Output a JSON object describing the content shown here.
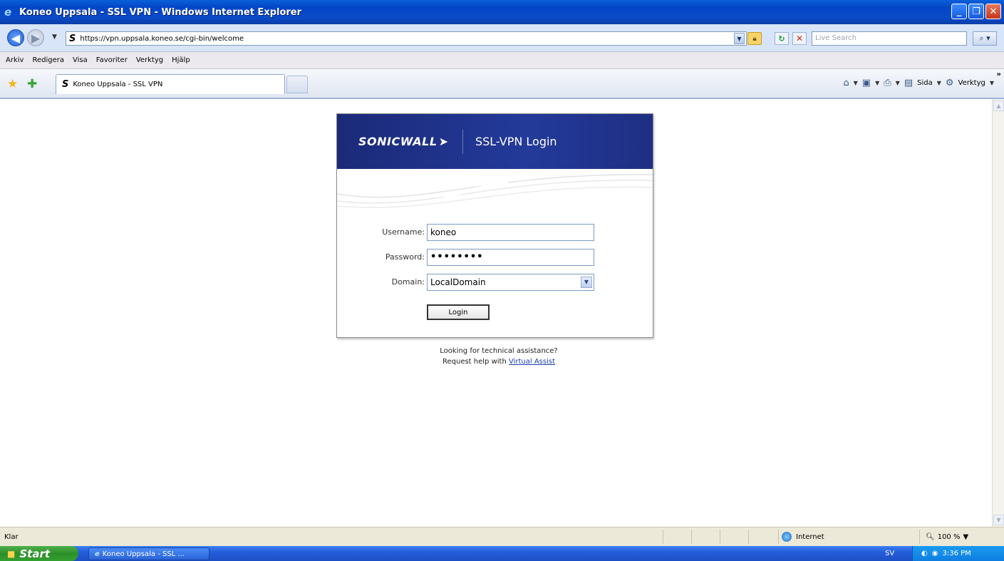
{
  "window": {
    "title": "Koneo Uppsala - SSL VPN - Windows Internet Explorer",
    "buttons": [
      "_",
      "❐",
      "✕"
    ]
  },
  "addressbar": {
    "url": "https://vpn.uppsala.koneo.se/cgi-bin/welcome",
    "search_placeholder": "Live Search"
  },
  "menu": {
    "items": [
      "Arkiv",
      "Redigera",
      "Visa",
      "Favoriter",
      "Verktyg",
      "Hjälp"
    ]
  },
  "tabs": {
    "active_label": "Koneo Uppsala - SSL VPN"
  },
  "commandbar": {
    "page_label": "Sida",
    "tools_label": "Verktyg"
  },
  "login": {
    "brand": "SONICWALL",
    "title": "SSL-VPN Login",
    "username_label": "Username:",
    "username_value": "koneo",
    "password_label": "Password:",
    "password_value": "••••••••",
    "domain_label": "Domain:",
    "domain_value": "LocalDomain",
    "button_label": "Login"
  },
  "help": {
    "line1": "Looking for technical assistance?",
    "line2_prefix": "Request help with",
    "link": "Virtual Assist"
  },
  "status": {
    "text": "Klar",
    "zone": "Internet",
    "zoom": "100 %"
  },
  "taskbar": {
    "start": "Start",
    "task": "Koneo Uppsala - SSL ...",
    "lang": "SV",
    "clock": "3:36 PM"
  },
  "colors": {
    "header_blue": "#1f3088",
    "link_blue": "#1a3fb0",
    "xp_title_blue": "#0346c7",
    "start_green": "#2c8f29"
  },
  "icons": [
    "ie-icon",
    "back-icon",
    "forward-icon",
    "lock-icon",
    "refresh-icon",
    "stop-icon",
    "search-icon",
    "star-icon",
    "add-favorite-icon",
    "home-icon",
    "feed-icon",
    "print-icon",
    "page-icon",
    "tools-icon",
    "globe-icon",
    "zoom-icon",
    "windows-flag-icon"
  ]
}
